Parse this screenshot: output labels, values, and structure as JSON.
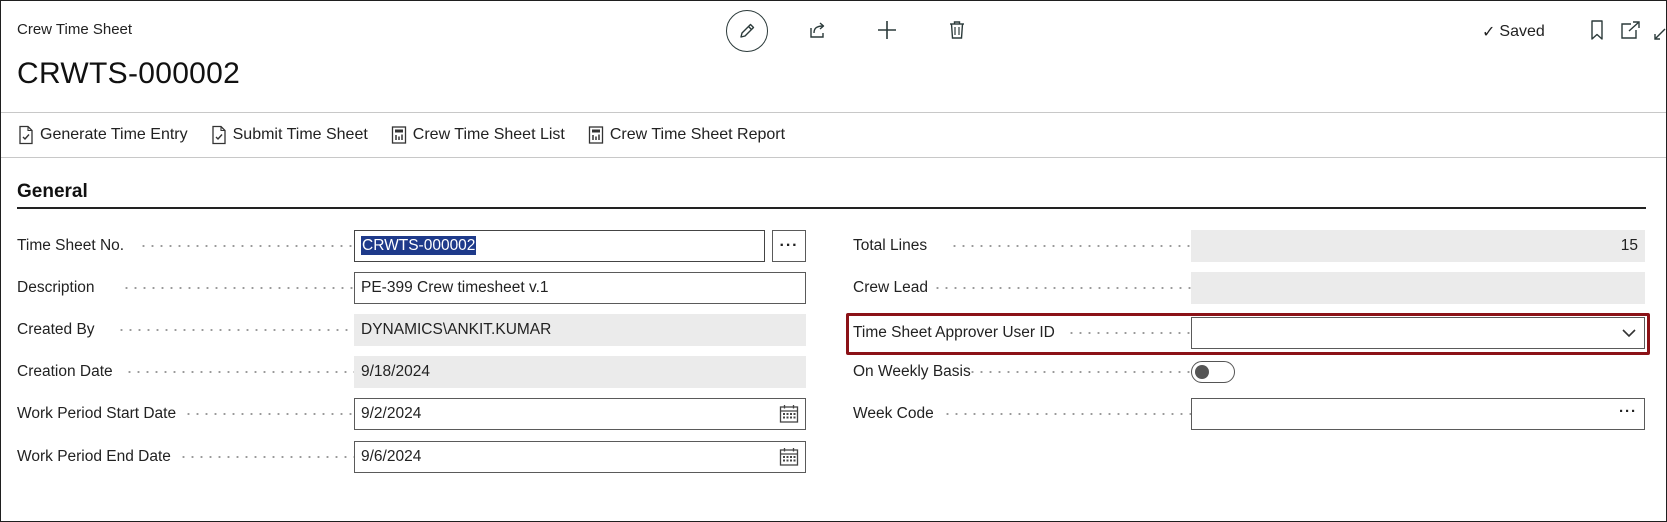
{
  "header": {
    "app_caption": "Crew Time Sheet",
    "record_title": "CRWTS-000002",
    "saved_label": "Saved",
    "saved_check": "✓",
    "icons": [
      "edit-icon",
      "share-icon",
      "new-icon",
      "delete-icon",
      "bookmark-icon",
      "popout-icon",
      "collapse-icon"
    ]
  },
  "actions": [
    {
      "label": "Generate Time Entry",
      "icon": "document-check-icon"
    },
    {
      "label": "Submit Time Sheet",
      "icon": "document-check-icon"
    },
    {
      "label": "Crew Time Sheet List",
      "icon": "report-icon"
    },
    {
      "label": "Crew Time Sheet Report",
      "icon": "report-icon"
    }
  ],
  "section": {
    "title": "General"
  },
  "left_fields": [
    {
      "label": "Time Sheet No.",
      "value": "CRWTS-000002",
      "selected": true,
      "assist_label": "···"
    },
    {
      "label": "Description",
      "value": "PE-399 Crew timesheet v.1"
    },
    {
      "label": "Created By",
      "value": "DYNAMICS\\ANKIT.KUMAR",
      "readonly": true
    },
    {
      "label": "Creation Date",
      "value": "9/18/2024",
      "readonly": true
    },
    {
      "label": "Work Period Start Date",
      "value": "9/2/2024",
      "icon": "calendar-icon"
    },
    {
      "label": "Work Period End Date",
      "value": "9/6/2024",
      "icon": "calendar-icon"
    }
  ],
  "right_fields": [
    {
      "label": "Total Lines",
      "value": "15",
      "readonly": true
    },
    {
      "label": "Crew Lead",
      "value": "",
      "readonly": true
    },
    {
      "label": "Time Sheet Approver User ID",
      "value": "",
      "highlighted": true,
      "icon": "chevron-down-icon"
    },
    {
      "label": "On Weekly Basis",
      "toggle_on": false
    },
    {
      "label": "Week Code",
      "value": "",
      "assist_label": "···"
    }
  ],
  "colors": {
    "highlight_border": "#8b1217",
    "selection_bg": "#1e3a8a",
    "readonly_bg": "#ebebeb"
  }
}
